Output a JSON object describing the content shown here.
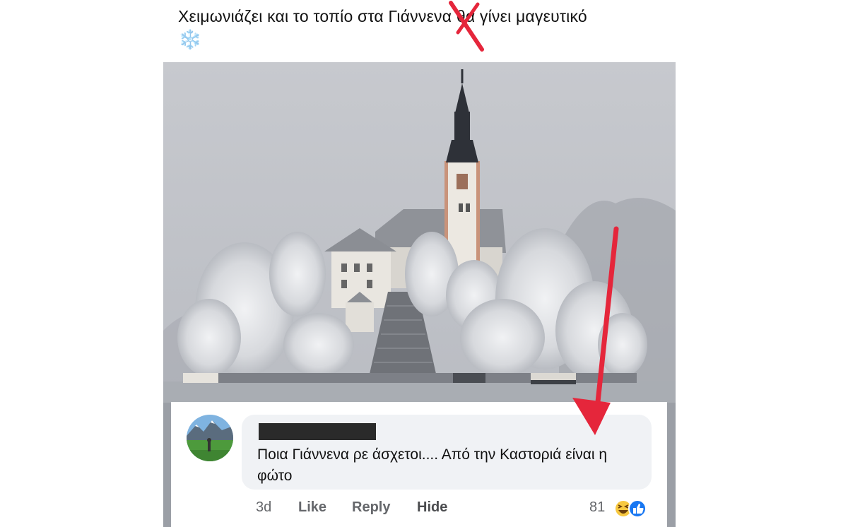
{
  "post": {
    "caption": "Χειμωνιάζει και το τοπίο στα Γιάννενα θα γίνει μαγευτικό",
    "emoji": "❄️"
  },
  "comment": {
    "text": "Ποια Γιάννενα ρε άσχετοι.... Από την Καστοριά είναι η φώτο",
    "time": "3d",
    "like_label": "Like",
    "reply_label": "Reply",
    "hide_label": "Hide",
    "reaction_count": "81",
    "reactions": [
      "haha-emoji",
      "like-emoji"
    ]
  },
  "colors": {
    "annotation_red": "#e5263b",
    "bubble_bg": "#f0f2f5",
    "action_gray": "#65676b",
    "like_blue": "#1877f2"
  }
}
